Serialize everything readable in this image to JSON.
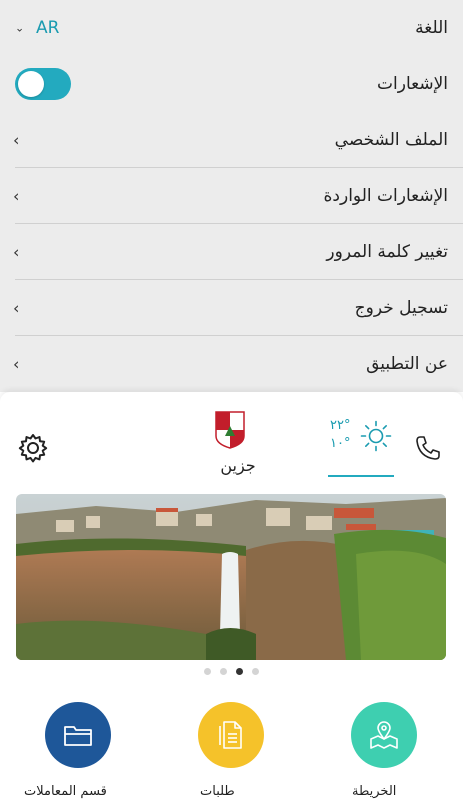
{
  "settings": {
    "language": {
      "label": "اللغة",
      "value": "AR"
    },
    "notifications": {
      "label": "الإشعارات",
      "enabled": true
    },
    "items": [
      {
        "label": "الملف الشخصي"
      },
      {
        "label": "الإشعارات الواردة"
      },
      {
        "label": "تغيير كلمة المرور"
      },
      {
        "label": "تسجيل خروج"
      },
      {
        "label": "عن التطبيق"
      }
    ]
  },
  "home": {
    "town_name": "جزين",
    "weather": {
      "high": "٢٢°",
      "low": "١٠°",
      "icon": "sun-icon"
    },
    "icons": {
      "settings": "gear-icon",
      "call": "phone-icon"
    },
    "carousel": {
      "slide_count": 4,
      "active_index": 2
    },
    "actions": [
      {
        "icon": "map-icon",
        "color": "#3ecfb0",
        "caption": "الخريطة"
      },
      {
        "icon": "document-icon",
        "color": "#f5c22a",
        "caption": "طلبات"
      },
      {
        "icon": "folder-icon",
        "color": "#1e5799",
        "caption": "قسم المعاملات"
      }
    ]
  },
  "colors": {
    "accent": "#23aabf",
    "background": "#ececec"
  }
}
